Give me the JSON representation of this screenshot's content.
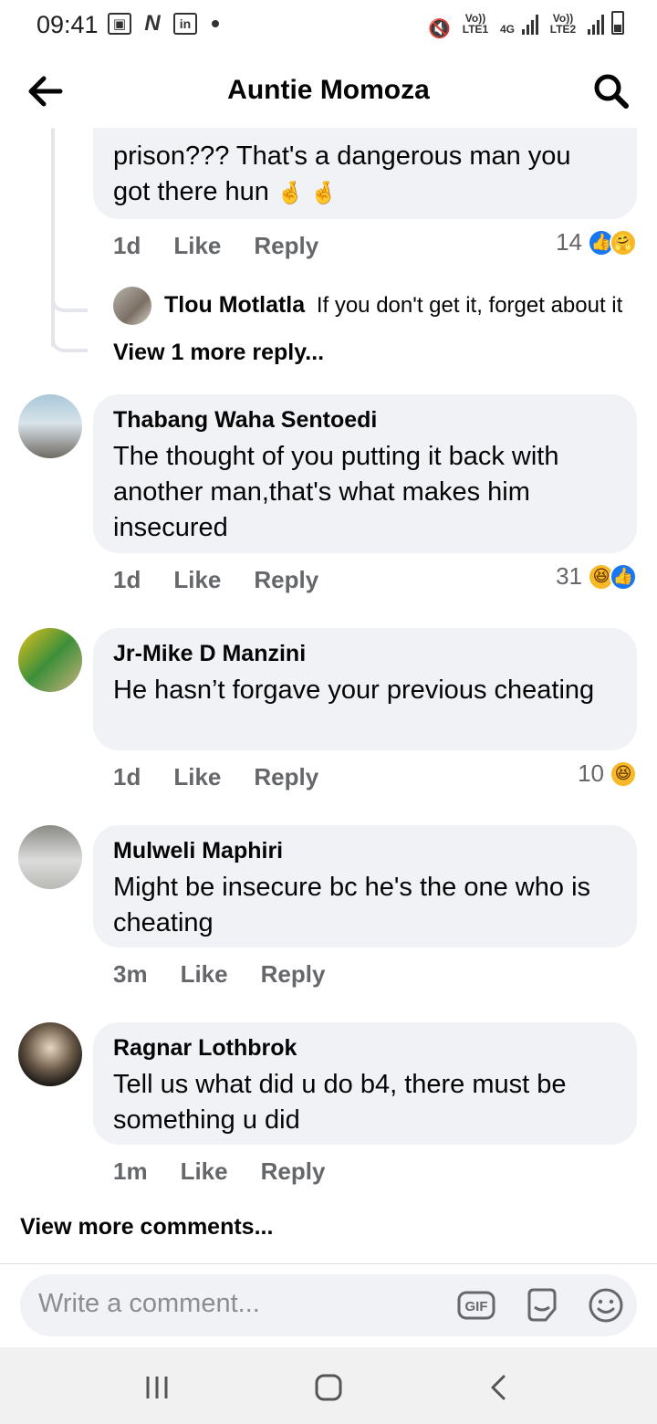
{
  "status": {
    "time": "09:41",
    "sim1": "Vo)) LTE1",
    "net": "4G",
    "sim2": "Vo)) LTE2"
  },
  "header": {
    "title": "Auntie Momoza"
  },
  "comments": {
    "top": {
      "text_line1": "prison??? That's a dangerous man you",
      "text_line2": "got there hun",
      "emoji": "🤞 🤞",
      "time": "1d",
      "like": "Like",
      "reply": "Reply",
      "reaction_count": "14"
    },
    "reply1": {
      "author": "Tlou Motlatla",
      "text": "If you don't get it, forget about it"
    },
    "view_more_reply": "View 1 more reply...",
    "c1": {
      "author": "Thabang Waha Sentoedi",
      "text": "The thought of you putting it back with another man,that's what makes him insecured",
      "time": "1d",
      "like": "Like",
      "reply": "Reply",
      "reaction_count": "31"
    },
    "c2": {
      "author": "Jr-Mike D Manzini",
      "text": "He hasn’t forgave your previous cheating",
      "time": "1d",
      "like": "Like",
      "reply": "Reply",
      "reaction_count": "10"
    },
    "c3": {
      "author": "Mulweli Maphiri",
      "text": "Might be insecure bc he's the one who is cheating",
      "time": "3m",
      "like": "Like",
      "reply": "Reply"
    },
    "c4": {
      "author": "Ragnar Lothbrok",
      "text": "Tell us what did u do b4, there must be something u did",
      "time": "1m",
      "like": "Like",
      "reply": "Reply"
    },
    "view_more_comments": "View more comments..."
  },
  "composer": {
    "placeholder": "Write a comment...",
    "gif_label": "GIF"
  },
  "colors": {
    "bubble": "#f0f2f5",
    "like_blue": "#1877f2",
    "haha_yellow": "#f7b928",
    "secondary_text": "#65676b"
  }
}
